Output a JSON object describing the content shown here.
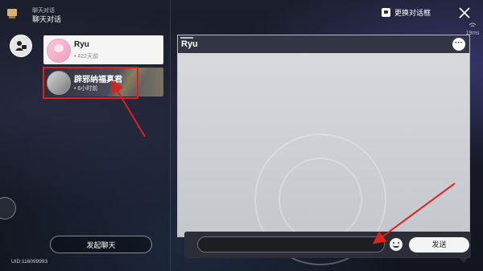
{
  "header": {
    "subtitle": "聊天对话",
    "title": "聊天对话",
    "change_dialog_label": "更换对话框"
  },
  "status": {
    "ping": "19ms"
  },
  "chat_list": [
    {
      "name": "Ryu",
      "time": "• 422天前"
    },
    {
      "name": "辟邪纳福真君",
      "time": "• 6小时前"
    }
  ],
  "start_chat_label": "发起聊天",
  "uid_text": "UID:116099993",
  "chat_panel": {
    "title": "Ryu",
    "more_label": "···"
  },
  "input": {
    "value": "",
    "send_label": "发送"
  },
  "colors": {
    "highlight_red": "#e0201a"
  }
}
